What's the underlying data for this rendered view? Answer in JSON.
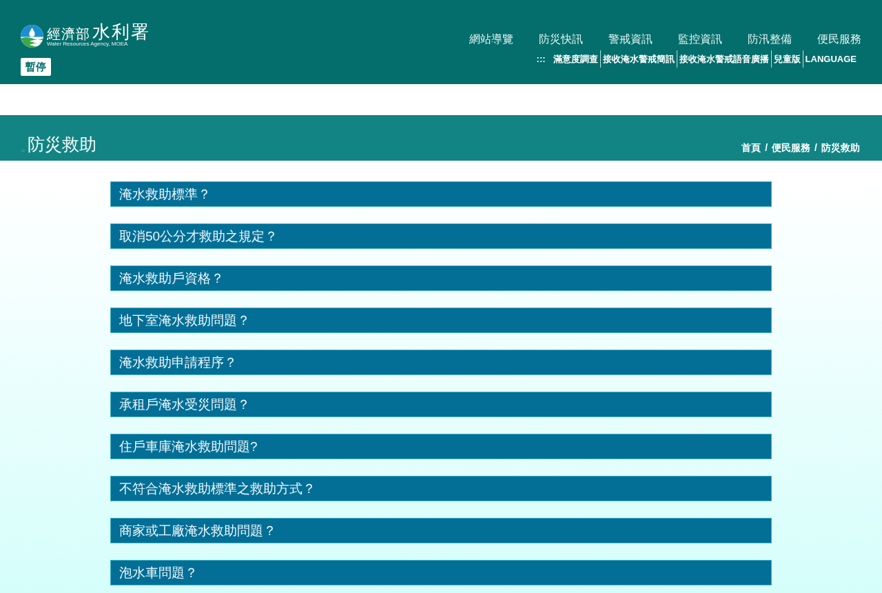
{
  "header": {
    "logo": {
      "ministry": "經濟部",
      "agency": "水利署",
      "subtitle": "Water Resources Agency, MOEA"
    },
    "pause_button": "暫停",
    "main_nav": [
      "網站導覽",
      "防災快訊",
      "警戒資訊",
      "監控資訊",
      "防汛整備",
      "便民服務"
    ],
    "sub_nav": {
      "accesskey": ":::",
      "items": [
        "滿意度調查",
        "接收淹水警戒簡訊",
        "接收淹水警戒語音廣播",
        "兒童版",
        "LANGUAGE"
      ]
    }
  },
  "page_title": {
    "accesskey": ":::",
    "title": "防災救助",
    "breadcrumb": [
      {
        "label": "首頁"
      },
      {
        "separator": "/",
        "label": "便民服務"
      },
      {
        "separator": "/",
        "label": "防災救助"
      }
    ]
  },
  "faq": [
    {
      "question": "淹水救助標準？"
    },
    {
      "question": "取消50公分才救助之規定？"
    },
    {
      "question": "淹水救助戶資格？"
    },
    {
      "question": "地下室淹水救助問題？"
    },
    {
      "question": "淹水救助申請程序？"
    },
    {
      "question": "承租戶淹水受災問題？"
    },
    {
      "question": "住戶車庫淹水救助問題?"
    },
    {
      "question": "不符合淹水救助標準之救助方式？"
    },
    {
      "question": "商家或工廠淹水救助問題？"
    },
    {
      "question": "泡水車問題？"
    }
  ]
}
